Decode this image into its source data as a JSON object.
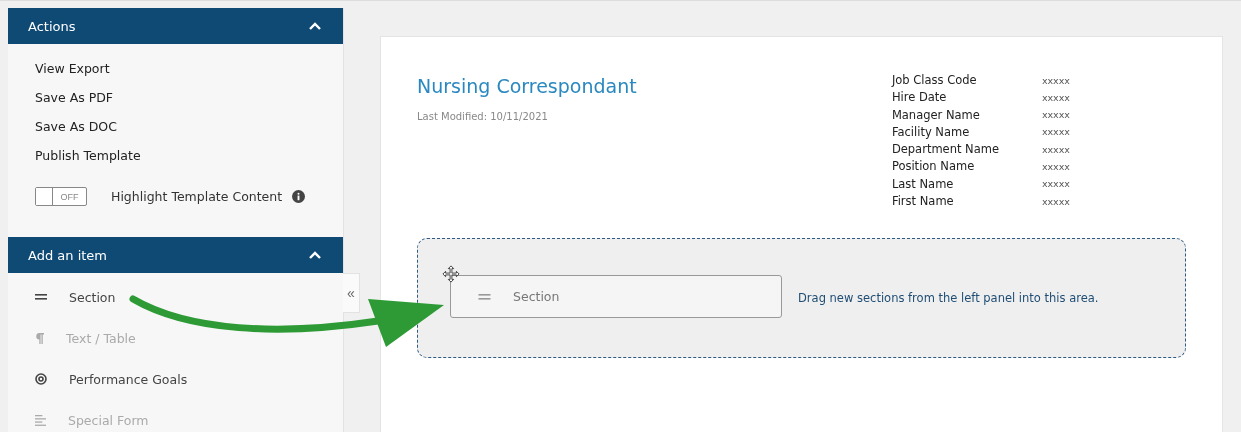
{
  "sidebar": {
    "sections": [
      {
        "kind": "actions",
        "title": "Actions",
        "expanded": true,
        "items": [
          {
            "label": "View Export"
          },
          {
            "label": "Save As PDF"
          },
          {
            "label": "Save As DOC"
          },
          {
            "label": "Publish Template"
          }
        ],
        "toggle": {
          "state_label": "OFF",
          "on": false,
          "label": "Highlight Template Content"
        }
      },
      {
        "kind": "items",
        "title": "Add an item",
        "expanded": true,
        "items": [
          {
            "label": "Section",
            "kind": "section",
            "disabled": false
          },
          {
            "label": "Text / Table",
            "kind": "text",
            "disabled": true
          },
          {
            "label": "Performance Goals",
            "kind": "goals",
            "disabled": false
          },
          {
            "label": "Special Form",
            "kind": "form",
            "disabled": true
          }
        ]
      }
    ],
    "collapse_glyph": "«"
  },
  "document": {
    "title": "Nursing Correspondant",
    "last_modified": "Last Modified: 10/11/2021",
    "fields": [
      {
        "label": "Job Class Code",
        "value": "xxxxx"
      },
      {
        "label": "Hire Date",
        "value": "xxxxx"
      },
      {
        "label": "Manager Name",
        "value": "xxxxx"
      },
      {
        "label": "Facility Name",
        "value": "xxxxx"
      },
      {
        "label": "Department Name",
        "value": "xxxxx"
      },
      {
        "label": "Position Name",
        "value": "xxxxx"
      },
      {
        "label": "Last Name",
        "value": "xxxxx"
      },
      {
        "label": "First Name",
        "value": "xxxxx"
      }
    ],
    "drop_zone": {
      "hint": "Drag new sections from the left panel into this area.",
      "dragged_item": {
        "label": "Section"
      }
    }
  }
}
